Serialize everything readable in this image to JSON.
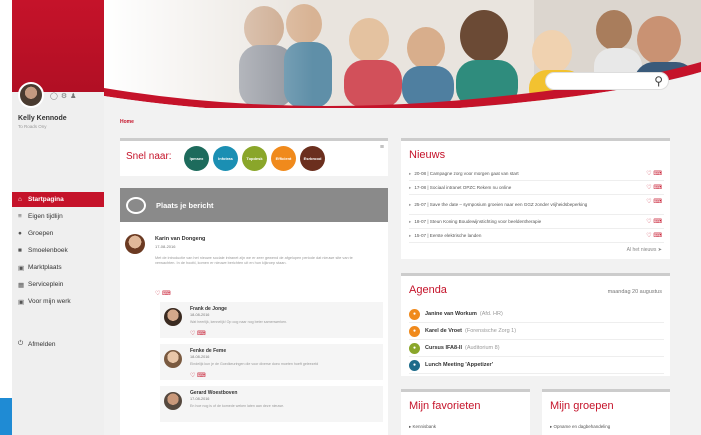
{
  "sidebar": {
    "user_name": "Kelly Kennode",
    "user_sub": "To Roads Ony",
    "items": [
      {
        "label": "Startpagina",
        "icon": "home-icon",
        "active": true
      },
      {
        "label": "Eigen tijdlijn",
        "icon": "timeline-icon",
        "active": false
      },
      {
        "label": "Groepen",
        "icon": "groups-icon",
        "active": false
      },
      {
        "label": "Smoelenboek",
        "icon": "contacts-icon",
        "active": false
      },
      {
        "label": "Marktplaats",
        "icon": "market-icon",
        "active": false
      },
      {
        "label": "Serviceplein",
        "icon": "service-icon",
        "active": false
      },
      {
        "label": "Voor mijn werk",
        "icon": "briefcase-icon",
        "active": false
      }
    ],
    "logout_label": "Afmelden"
  },
  "breadcrumb": "Home",
  "search": {
    "placeholder": ""
  },
  "snel_naar": {
    "label": "Snel naar:",
    "items": [
      {
        "label": "Ipmsex",
        "color": "#1d6b5c"
      },
      {
        "label": "Infotras",
        "color": "#1b8fb3"
      },
      {
        "label": "Topdesk",
        "color": "#8aa62a"
      },
      {
        "label": "Efficient",
        "color": "#f08a1c"
      },
      {
        "label": "Esrbrood",
        "color": "#6b2f1e"
      }
    ]
  },
  "post_panel": {
    "header": "Plaats je bericht",
    "post": {
      "name": "Karin van Dongeng",
      "date": "17-08-2016",
      "text": "Met de introductie van het nieuwe sociale intranet zijn we er zeer gewend de afgelopen periode dat nieuwe site van te verwachten. In de hoofd, komen er nieuwe berichten uit en hun kijkroep staan."
    },
    "replies": [
      {
        "name": "Frank de Jonge",
        "date": "18-08-2016",
        "text": "Wat heerlijk, kennelijk! Op oog naar nog beter samenwerken."
      },
      {
        "name": "Fenke de Feme",
        "date": "18-08-2016",
        "text": "Eindelijk kun je de Goedkeuringen die voor diverse doeo moeten hoeft geleezeld"
      },
      {
        "name": "Gerard Woestboven",
        "date": "17-08-2016",
        "text": "En hoe nog is of de komede weken laten aan deze nieuwe."
      }
    ]
  },
  "news": {
    "title": "Nieuws",
    "items": [
      "20-08 | Campagne zorg voor morgen gaat van start",
      "17-08 | Sociaal intranet OPZC Rekem nu online",
      "25-07 | Save the date – symposium groeien naar een GGZ zonder vrijheidsbeperking",
      "18-07 | Steun Koning Boudewijnstichting voor beeldentherapie",
      "15-07 | Eerste elektrische landen"
    ],
    "all_label": "Al het nieuws"
  },
  "agenda": {
    "title": "Agenda",
    "date": "maandag 20 augustus",
    "items": [
      {
        "name": "Janine van Workum",
        "location": "(Afd. HR)",
        "color": "#f08a1c"
      },
      {
        "name": "Karel de Vroet",
        "location": "(Forensische Zorg 1)",
        "color": "#f08a1c"
      },
      {
        "name": "Cursus IFA8-II",
        "location": "(Auditorium 8)",
        "color": "#8aa62a"
      },
      {
        "name": "Lunch Meeting 'Appetizer'",
        "location": "",
        "color": "#1d6b8a"
      }
    ]
  },
  "favorites": {
    "title": "Mijn favorieten",
    "first": "Kennisbank"
  },
  "groups": {
    "title": "Mijn groepen",
    "first": "Opname en dagbehandeling"
  }
}
